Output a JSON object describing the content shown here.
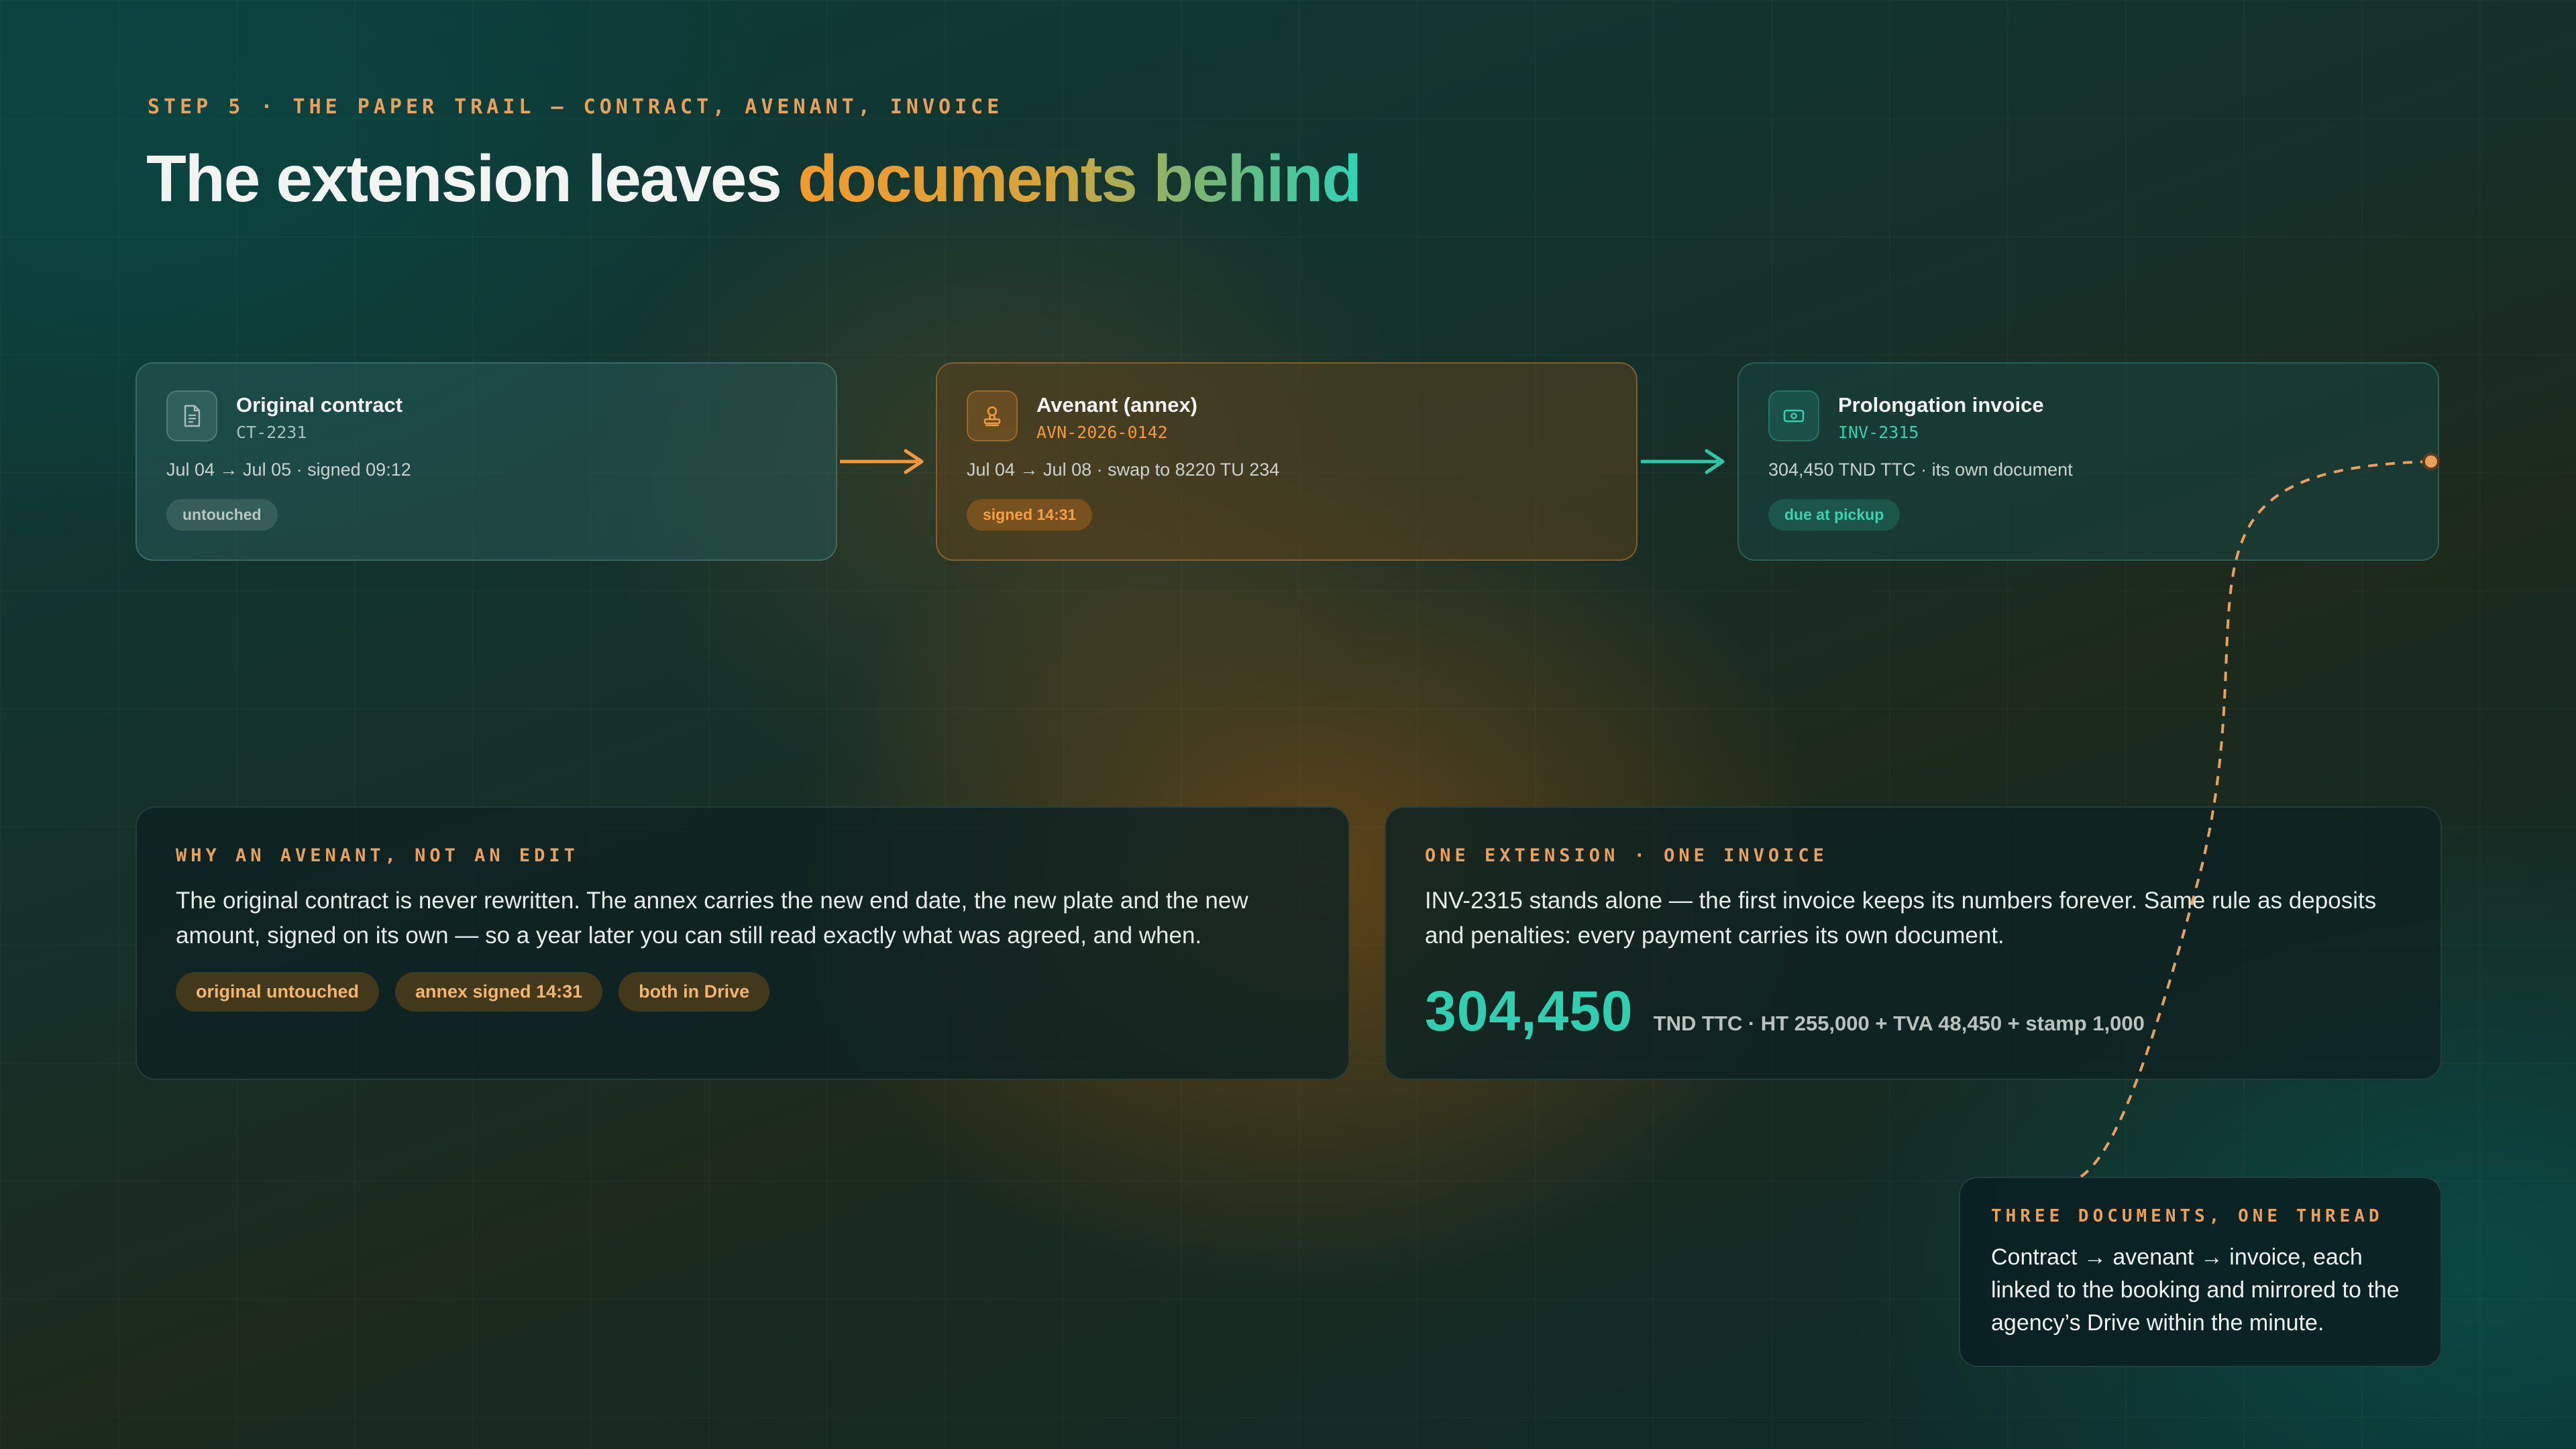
{
  "header": {
    "eyebrow": "STEP 5 · THE PAPER TRAIL — CONTRACT, AVENANT, INVOICE",
    "title_plain": "The extension leaves ",
    "title_highlight": "documents behind"
  },
  "documents": [
    {
      "title": "Original contract",
      "code": "CT-2231",
      "meta": "Jul 04 → Jul 05 · signed 09:12",
      "status": "untouched",
      "icon": "document-icon"
    },
    {
      "title": "Avenant (annex)",
      "code": "AVN-2026-0142",
      "meta": "Jul 04 → Jul 08 · swap to 8220 TU 234",
      "status": "signed 14:31",
      "icon": "stamp-icon"
    },
    {
      "title": "Prolongation invoice",
      "code": "INV-2315",
      "meta": "304,450 TND TTC · its own document",
      "status": "due at pickup",
      "icon": "banknote-icon"
    }
  ],
  "why": {
    "label": "WHY AN AVENANT, NOT AN EDIT",
    "body": "The original contract is never rewritten. The annex carries the new end date, the new plate and the new amount, signed on its own — so a year later you can still read exactly what was agreed, and when.",
    "tags": [
      "original untouched",
      "annex signed 14:31",
      "both in Drive"
    ]
  },
  "one": {
    "label": "ONE EXTENSION · ONE INVOICE",
    "body": "INV-2315 stands alone — the first invoice keeps its numbers forever. Same rule as deposits and penalties: every payment carries its own document.",
    "amount": "304,450",
    "breakdown": "TND TTC · HT 255,000 + TVA 48,450 + stamp 1,000"
  },
  "callout": {
    "label": "THREE DOCUMENTS, ONE THREAD",
    "body": "Contract → avenant → invoice, each linked to the booking and mirrored to the agency’s Drive within the minute."
  },
  "colors": {
    "accent_orange": "#f49a2c",
    "accent_teal": "#2fd3b6",
    "label_amber": "#e9a05a"
  }
}
